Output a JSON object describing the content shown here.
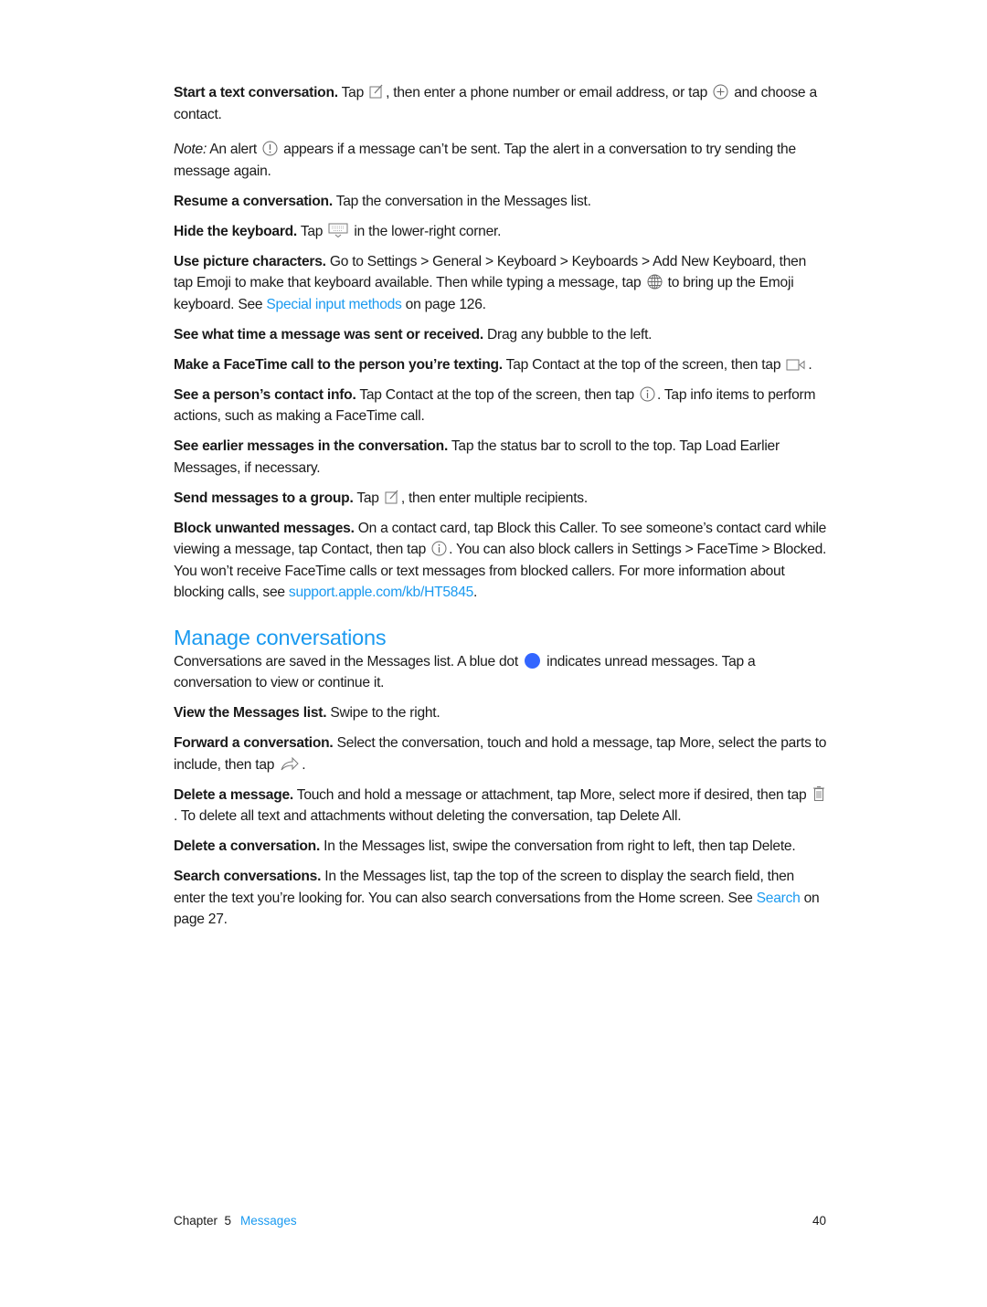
{
  "paragraphs": {
    "start": {
      "title": "Start a text conversation.",
      "t1": " Tap ",
      "t2": ", then enter a phone number or email address, or tap ",
      "t3": " and choose a contact."
    },
    "note": {
      "title": "Note:",
      "t1": "  An alert ",
      "t2": " appears if a message can’t be sent. Tap the alert in a conversation to try sending the message again."
    },
    "resume": {
      "title": "Resume a conversation.",
      "t1": " Tap the conversation in the Messages list."
    },
    "hide": {
      "title": "Hide the keyboard.",
      "t1": " Tap ",
      "t2": " in the lower-right corner."
    },
    "emoji": {
      "title": "Use picture characters.",
      "t1": " Go to Settings > General > Keyboard > Keyboards > Add New Keyboard, then tap Emoji to make that keyboard available. Then while typing a message, tap ",
      "t2": " to bring up the Emoji keyboard. See ",
      "link": "Special input methods",
      "t3": " on page 126."
    },
    "time": {
      "title": "See what time a message was sent or received.",
      "t1": " Drag any bubble to the left."
    },
    "facetime": {
      "title": "Make a FaceTime call to the person you’re texting.",
      "t1": " Tap Contact at the top of the screen, then tap ",
      "t2": "."
    },
    "contact": {
      "title": "See a person’s contact info.",
      "t1": " Tap Contact at the top of the screen, then tap ",
      "t2": ". Tap info items to perform actions, such as making a FaceTime call."
    },
    "earlier": {
      "title": "See earlier messages in the conversation.",
      "t1": " Tap the status bar to scroll to the top. Tap Load Earlier Messages, if necessary."
    },
    "group": {
      "title": "Send messages to a group.",
      "t1": " Tap ",
      "t2": ", then enter multiple recipients."
    },
    "block": {
      "title": "Block unwanted messages.",
      "t1": " On a contact card, tap Block this Caller. To see someone’s contact card while viewing a message, tap Contact, then tap ",
      "t2": ". You can also block callers in Settings > FaceTime > Blocked. You won’t receive FaceTime calls or text messages from blocked callers. For more information about blocking calls, see ",
      "link": "support.apple.com/kb/HT5845",
      "t3": "."
    }
  },
  "section": {
    "heading": "Manage conversations",
    "intro": {
      "t1": "Conversations are saved in the Messages list. A blue dot ",
      "t2": " indicates unread messages. Tap a conversation to view or continue it."
    },
    "view": {
      "title": "View the Messages list.",
      "t1": " Swipe to the right."
    },
    "forward": {
      "title": "Forward a conversation.",
      "t1": " Select the conversation, touch and hold a message, tap More, select the parts to include, then tap ",
      "t2": "."
    },
    "delmsg": {
      "title": "Delete a message.",
      "t1": " Touch and hold a message or attachment, tap More, select more if desired, then tap ",
      "t2": ". To delete all text and attachments without deleting the conversation, tap Delete All."
    },
    "delconv": {
      "title": "Delete a conversation.",
      "t1": " In the Messages list, swipe the conversation from right to left, then tap Delete."
    },
    "search": {
      "title": "Search conversations.",
      "t1": " In the Messages list, tap the top of the screen to display the search field, then enter the text you’re looking for. You can also search conversations from the Home screen. See ",
      "link": "Search",
      "t2": " on page 27."
    }
  },
  "colors": {
    "link": "#1a9af0",
    "unread_dot": "#3366ff"
  },
  "footer": {
    "chapter": "Chapter  5",
    "chapter_name": "Messages",
    "page_number": "40"
  }
}
